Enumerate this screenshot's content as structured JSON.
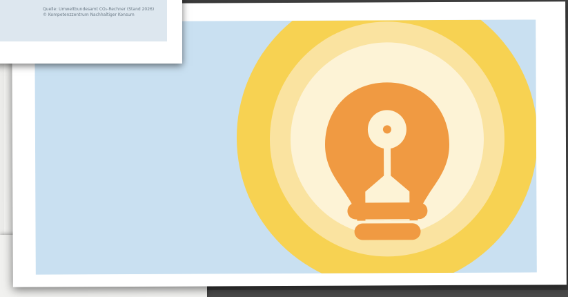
{
  "source_caption": {
    "line1": "Quelle: Umweltbundesamt CO₂-Rechner (Stand 2026)",
    "line2": "© Kompetenzzentrum Nachhaltiger Konsum"
  },
  "illustration": {
    "subject": "lightbulb-illustration",
    "colors": {
      "background": "#c9e0f1",
      "outer_glow": "#f7d252",
      "mid_glow": "#fae3a0",
      "inner_glow": "#fdf3d6",
      "bulb": "#f09a42",
      "filament": "#fdf3d6"
    }
  }
}
